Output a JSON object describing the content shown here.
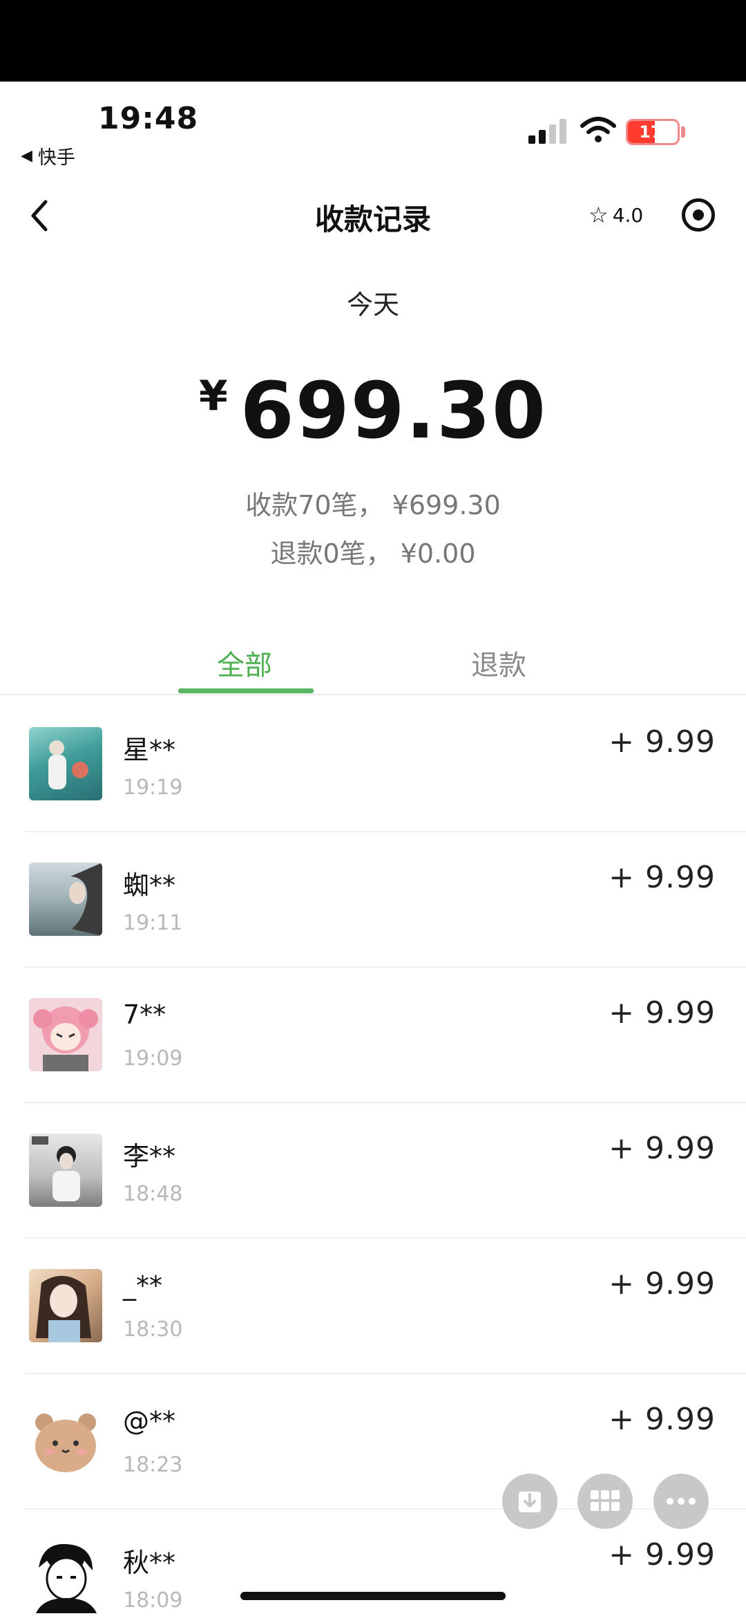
{
  "status": {
    "time": "19:48",
    "back_app": "快手",
    "battery": "17",
    "battery_level": 0.17
  },
  "nav": {
    "title": "收款记录",
    "rating": "4.0",
    "icons": [
      "back-chevron-icon",
      "star-outline-icon",
      "target-icon"
    ]
  },
  "summary": {
    "date": "今天",
    "currency": "¥",
    "total": "699.30",
    "received": "收款70笔， ¥699.30",
    "refunded": "退款0笔， ¥0.00"
  },
  "tabs": [
    {
      "label": "全部",
      "active": true
    },
    {
      "label": "退款",
      "active": false
    }
  ],
  "colors": {
    "accent": "#4caf50",
    "battery_red": "#ff3b30"
  },
  "transactions": [
    {
      "name": "星**",
      "time": "19:19",
      "amount": "+ 9.99",
      "avatar": "photo-teal-scene"
    },
    {
      "name": "蜘**",
      "time": "19:11",
      "amount": "+ 9.99",
      "avatar": "photo-sea-scene"
    },
    {
      "name": "7**",
      "time": "19:09",
      "amount": "+ 9.99",
      "avatar": "anime-pink-girl"
    },
    {
      "name": "李**",
      "time": "18:48",
      "amount": "+ 9.99",
      "avatar": "photo-portrait-grey"
    },
    {
      "name": "_**",
      "time": "18:30",
      "amount": "+ 9.99",
      "avatar": "photo-girl-warm"
    },
    {
      "name": "@**",
      "time": "18:23",
      "amount": "+ 9.99",
      "avatar": "cartoon-bear"
    },
    {
      "name": "秋**",
      "time": "18:09",
      "amount": "+ 9.99",
      "avatar": "drawing-black-hair"
    }
  ],
  "floating_buttons": [
    "download-icon",
    "grid-icon",
    "more-icon"
  ]
}
